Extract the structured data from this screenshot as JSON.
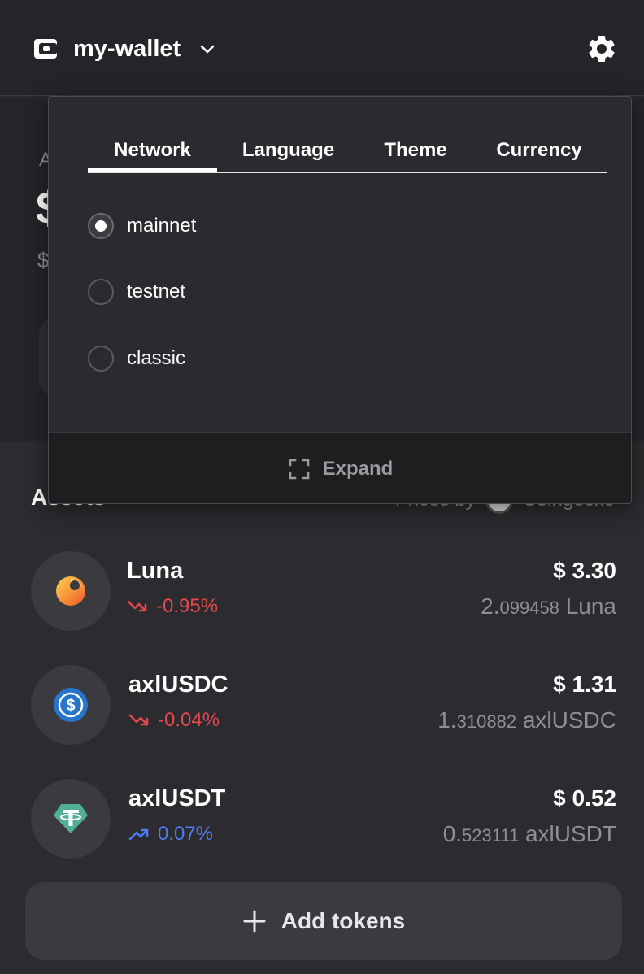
{
  "header": {
    "wallet_name": "my-wallet"
  },
  "hero": {
    "ghost_a": "A",
    "ghost_big": "$",
    "ghost_small": "$"
  },
  "settings": {
    "tabs": [
      {
        "label": "Network",
        "active": true
      },
      {
        "label": "Language",
        "active": false
      },
      {
        "label": "Theme",
        "active": false
      },
      {
        "label": "Currency",
        "active": false
      }
    ],
    "networks": [
      {
        "label": "mainnet",
        "selected": true
      },
      {
        "label": "testnet",
        "selected": false
      },
      {
        "label": "classic",
        "selected": false
      }
    ],
    "expand_label": "Expand"
  },
  "assets": {
    "title": "Assets",
    "prices_by": "Prices by",
    "prices_source": "Coingecko",
    "items": [
      {
        "name": "Luna",
        "change": "-0.95%",
        "direction": "down",
        "price": "$ 3.30",
        "amount_int": "2.",
        "amount_dec": "099458",
        "symbol": "Luna"
      },
      {
        "name": "axlUSDC",
        "change": "-0.04%",
        "direction": "down",
        "price": "$ 1.31",
        "amount_int": "1.",
        "amount_dec": "310882",
        "symbol": "axlUSDC"
      },
      {
        "name": "axlUSDT",
        "change": "0.07%",
        "direction": "up",
        "price": "$ 0.52",
        "amount_int": "0.",
        "amount_dec": "523111",
        "symbol": "axlUSDT"
      }
    ],
    "add_tokens_label": "Add tokens"
  },
  "colors": {
    "background": "#2c2c30",
    "header": "#252529",
    "negative": "#e5484d",
    "positive": "#4d7cf0"
  }
}
